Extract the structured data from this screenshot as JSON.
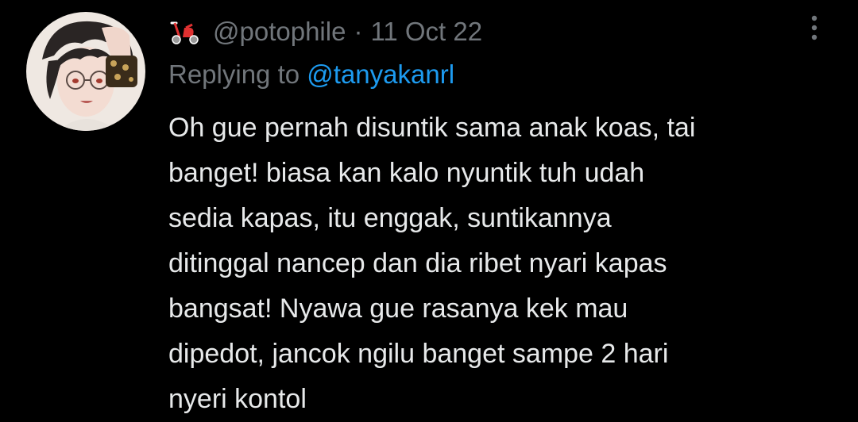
{
  "tweet": {
    "handle": "@potophile",
    "separator": "·",
    "timestamp": "11 Oct 22",
    "badge_icon": "scooter-icon",
    "reply": {
      "prefix": "Replying to",
      "target": "@tanyakanrl"
    },
    "body": "Oh gue pernah disuntik sama anak koas, tai\nbanget! biasa kan kalo nyuntik tuh udah\nsedia kapas, itu enggak, suntikannya\nditinggal nancep dan dia ribet nyari kapas\nbangsat! Nyawa gue rasanya kek mau\ndipedot, jancok ngilu banget sampe 2 hari\nnyeri kontol",
    "more_icon": "more-vertical-icon"
  },
  "colors": {
    "background": "#000000",
    "primary_text": "#e7e9ea",
    "secondary_text": "#71767b",
    "accent": "#1d9bf0"
  }
}
